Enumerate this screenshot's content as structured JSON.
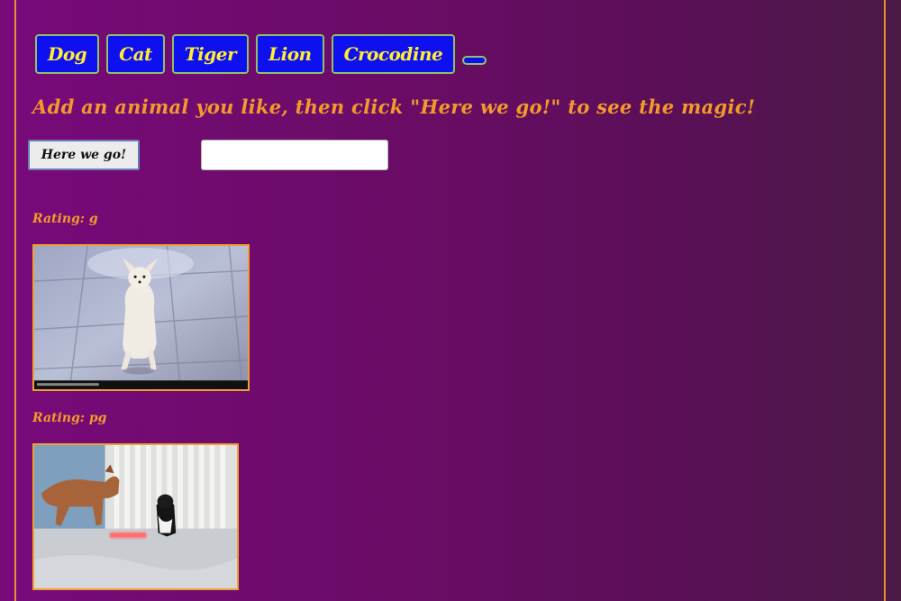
{
  "animal_buttons": [
    {
      "label": "Dog"
    },
    {
      "label": "Cat"
    },
    {
      "label": "Tiger"
    },
    {
      "label": "Lion"
    },
    {
      "label": "Crocodine"
    },
    {
      "label": ""
    }
  ],
  "instructions": "Add an animal you like, then click \"Here we go!\" to see the magic!",
  "go_button_label": "Here we go!",
  "animal_input": {
    "value": "",
    "placeholder": ""
  },
  "results": [
    {
      "rating_text": "Rating: g",
      "image_name": "chihuahua-standing-gif"
    },
    {
      "rating_text": "Rating: pg",
      "image_name": "dog-cat-laser-gif"
    }
  ],
  "colors": {
    "accent": "#f39a2a",
    "button_bg": "#0f10f0",
    "button_text": "#ffee33",
    "button_border": "#8ec267"
  }
}
